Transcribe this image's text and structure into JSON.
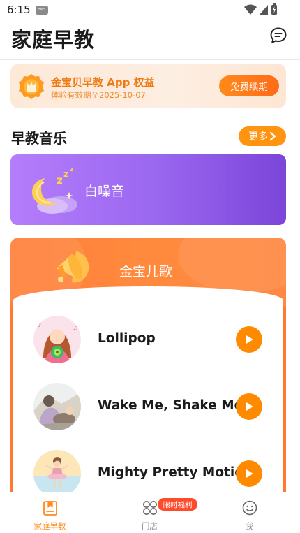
{
  "status_bar": {
    "time": "6:15",
    "hms_label": "HMS"
  },
  "header": {
    "title": "家庭早教",
    "chat_icon": "chat-bubble-icon"
  },
  "vip_banner": {
    "title": "金宝贝早教 App 权益",
    "subtitle": "体验有效期至2025-10-07",
    "renew_label": "免费续期",
    "badge_icon": "crown-badge-icon"
  },
  "music_section": {
    "title": "早教音乐",
    "more_label": "更多"
  },
  "white_noise": {
    "label": "白噪音",
    "icon": "sleeping-moon-icon"
  },
  "kids_songs": {
    "title": "金宝儿歌",
    "icon": "speaker-icon",
    "songs": [
      {
        "name": "Lollipop"
      },
      {
        "name": "Wake Me, Shake Me"
      },
      {
        "name": "Mighty Pretty Motion"
      }
    ]
  },
  "tab_bar": {
    "tabs": [
      {
        "label": "家庭早教",
        "icon": "home-book-icon",
        "active": true
      },
      {
        "label": "门店",
        "icon": "store-grid-icon",
        "active": false
      },
      {
        "label": "我",
        "icon": "smile-face-icon",
        "active": false
      }
    ],
    "promo_badge": "限时福利"
  },
  "colors": {
    "accent_orange": "#ff8a00",
    "vip_text": "#f07a10",
    "purple_card": "#9966ef",
    "song_card": "#ff7a2e",
    "promo_red": "#ff4b2b"
  }
}
